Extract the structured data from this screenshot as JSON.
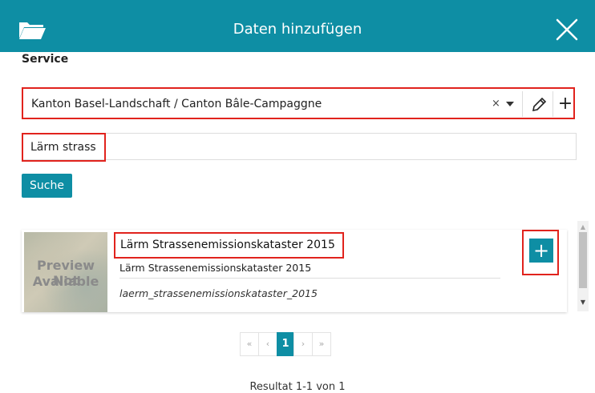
{
  "dialog": {
    "title": "Daten hinzufügen",
    "icons": {
      "left": "folder-open-icon",
      "close": "close-icon"
    },
    "accent_color": "#0e8ea4",
    "highlight_color": "#e1231d"
  },
  "service": {
    "label": "Service",
    "selected": "Kanton Basel-Landschaft / Canton Bâle-Campaggne",
    "clear_symbol": "×",
    "add_symbol": "+"
  },
  "search": {
    "value": "Lärm strass",
    "button_label": "Suche"
  },
  "results": [
    {
      "preview_text": [
        "Preview Not",
        "Avaliable"
      ],
      "title": "Lärm Strassenemissionskataster 2015",
      "description": "Lärm Strassenemissionskataster 2015",
      "name": "laerm_strassenemissionskataster_2015",
      "add_symbol": "+"
    }
  ],
  "pagination": {
    "first": "«",
    "prev": "‹",
    "current": "1",
    "next": "›",
    "last": "»"
  },
  "result_count": "Resultat 1-1 von 1"
}
